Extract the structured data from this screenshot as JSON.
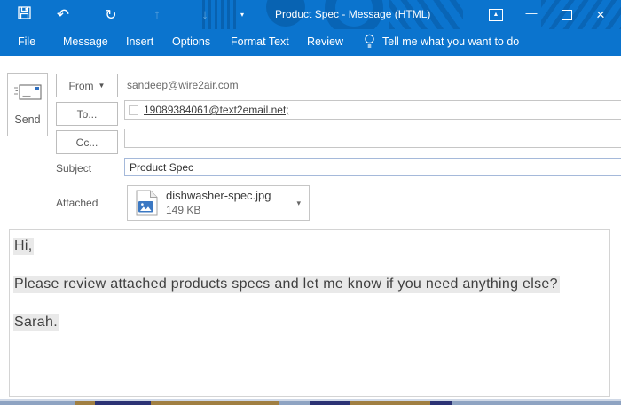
{
  "window": {
    "title": "Product Spec - Message (HTML)",
    "controls": {
      "minimize_glyph": "—",
      "close_glyph": "×",
      "ribbon_display_glyph": "▲"
    }
  },
  "qat": {
    "undo_glyph": "↶",
    "redo_glyph": "↻",
    "previous_glyph": "↑",
    "next_glyph": "↓",
    "customize_glyph": "▾"
  },
  "ribbon": {
    "tabs": [
      "File",
      "Message",
      "Insert",
      "Options",
      "Format Text",
      "Review"
    ],
    "tell_me": "Tell me what you want to do"
  },
  "compose": {
    "send_label": "Send",
    "from_label": "From",
    "from_caret": "▼",
    "from_value": "sandeep@wire2air.com",
    "to_label": "To...",
    "to_value": "19089384061@text2email.net;",
    "cc_label": "Cc...",
    "cc_value": "",
    "subject_label": "Subject",
    "subject_value": "Product Spec",
    "attached_label": "Attached",
    "attachment": {
      "filename": "dishwasher-spec.jpg",
      "size": "149 KB",
      "caret": "▾"
    }
  },
  "body": {
    "lines": [
      "Hi,",
      "Please review attached products specs and let me know if you need anything else?",
      "Sarah."
    ]
  },
  "colors": {
    "titlebar_blue": "#0b74ce",
    "focused_field_border": "#a5b9da",
    "selection_highlight": "#e9e9e9",
    "attachment_icon_blue": "#3b78c3"
  }
}
